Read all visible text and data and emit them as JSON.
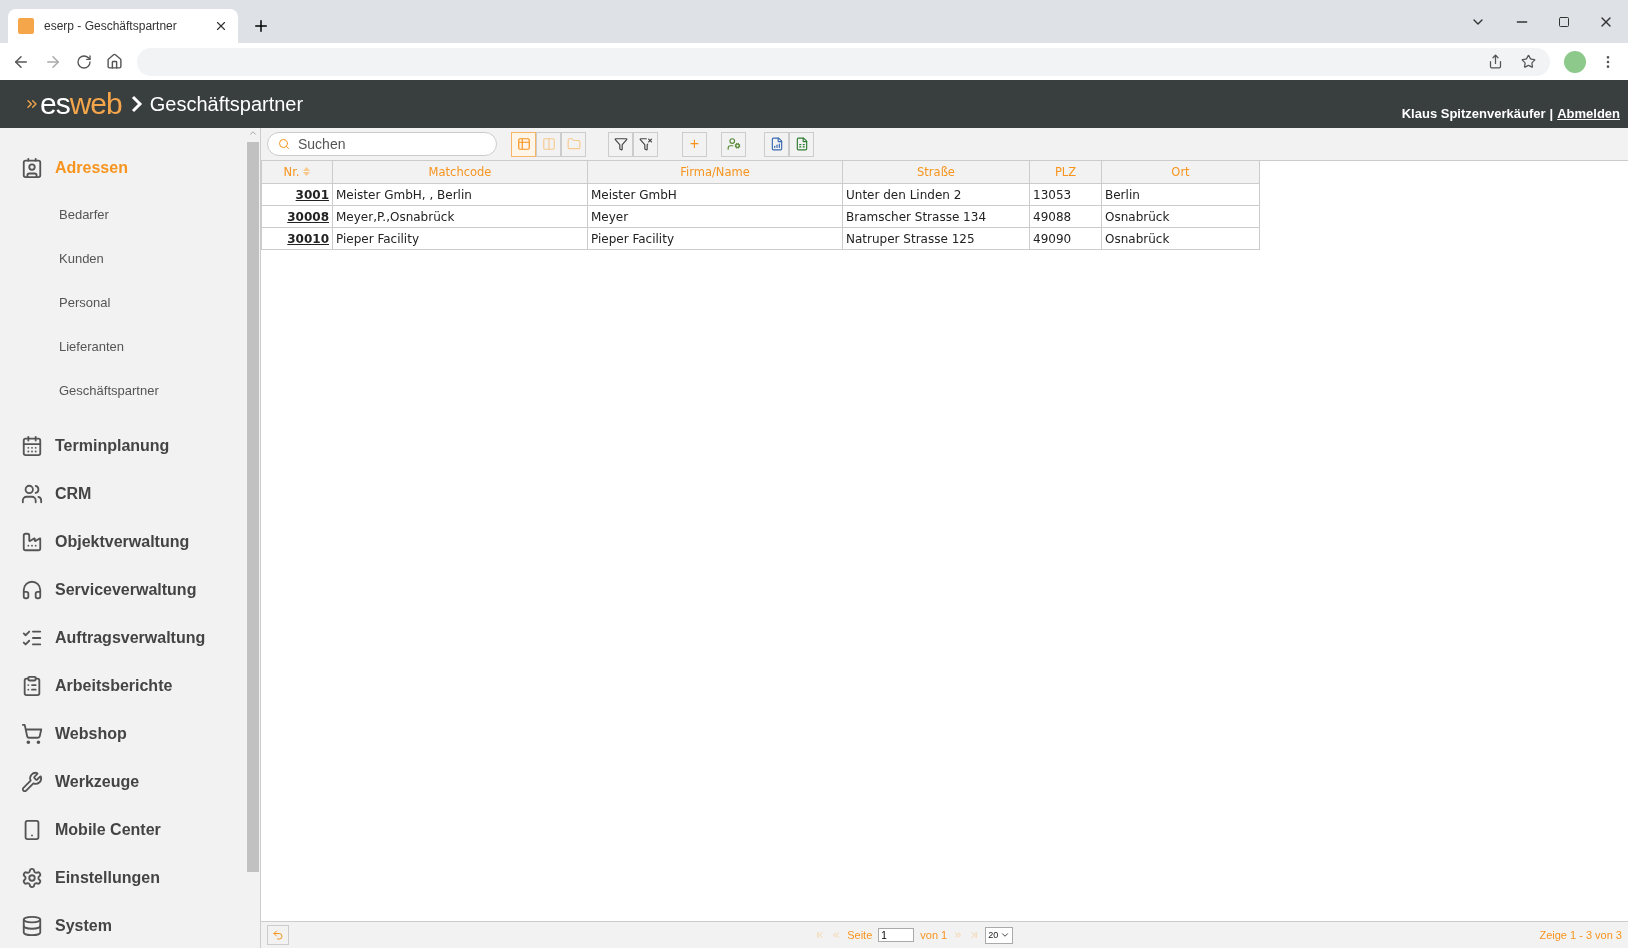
{
  "browser": {
    "tab_title": "eserp - Geschäftspartner"
  },
  "header": {
    "logo": [
      "es",
      "web"
    ],
    "breadcrumb": "Geschäftspartner",
    "user": "Klaus Spitzenverkäufer",
    "separator": "|",
    "logout": "Abmelden"
  },
  "sidebar": {
    "items": [
      {
        "label": "Adressen",
        "selected": true,
        "children": [
          "Bedarfer",
          "Kunden",
          "Personal",
          "Lieferanten",
          "Geschäftspartner"
        ]
      },
      {
        "label": "Terminplanung",
        "selected": false
      },
      {
        "label": "CRM",
        "selected": false
      },
      {
        "label": "Objektverwaltung",
        "selected": false
      },
      {
        "label": "Serviceverwaltung",
        "selected": false
      },
      {
        "label": "Auftragsverwaltung",
        "selected": false
      },
      {
        "label": "Arbeitsberichte",
        "selected": false
      },
      {
        "label": "Webshop",
        "selected": false
      },
      {
        "label": "Werkzeuge",
        "selected": false
      },
      {
        "label": "Mobile Center",
        "selected": false
      },
      {
        "label": "Einstellungen",
        "selected": false
      },
      {
        "label": "System",
        "selected": false
      }
    ]
  },
  "toolbar": {
    "search": {
      "placeholder": "Suchen"
    },
    "views": [
      {
        "selected": true
      },
      {
        "selected": false
      },
      {
        "selected": false
      }
    ],
    "add": "+"
  },
  "table": {
    "columns": [
      {
        "label": "Nr.",
        "sorted": true
      },
      {
        "label": "Matchcode",
        "sorted": false
      },
      {
        "label": "Firma/Name",
        "sorted": false
      },
      {
        "label": "Straße",
        "sorted": false
      },
      {
        "label": "PLZ",
        "sorted": false
      },
      {
        "label": "Ort",
        "sorted": false
      }
    ],
    "rows": [
      [
        "3001",
        "Meister GmbH, , Berlin",
        "Meister GmbH",
        "Unter den Linden 2",
        "13053",
        "Berlin"
      ],
      [
        "30008",
        "Meyer,P.,Osnabrück",
        "Meyer",
        "Bramscher Strasse 134",
        "49088",
        "Osnabrück"
      ],
      [
        "30010",
        "Pieper Facility",
        "Pieper Facility",
        "Natruper Strasse 125",
        "49090",
        "Osnabrück"
      ]
    ]
  },
  "pager": {
    "page_label": "Seite",
    "page": "1",
    "of": "von 1",
    "page_size": "20",
    "summary": "Zeige 1 - 3 von 3"
  }
}
